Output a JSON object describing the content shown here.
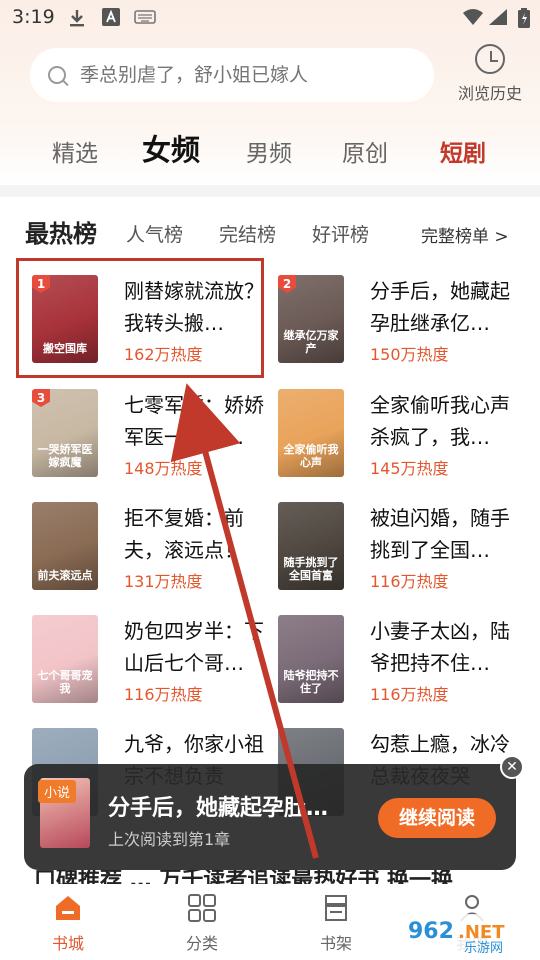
{
  "status": {
    "time": "3:19"
  },
  "search": {
    "placeholder": "季总别虐了，舒小姐已嫁人"
  },
  "history": {
    "label": "浏览历史"
  },
  "tabs": [
    "精选",
    "女频",
    "男频",
    "原创",
    "短剧"
  ],
  "section": {
    "title": "最热榜",
    "tabs": [
      "人气榜",
      "完结榜",
      "好评榜"
    ],
    "more": "完整榜单 >"
  },
  "books": [
    {
      "rank": "1",
      "title": "刚替嫁就流放？我转头搬…",
      "heat": "162万热度",
      "cover_text": "搬空国库",
      "cover_color": "#a8323a"
    },
    {
      "rank": "2",
      "title": "分手后，她藏起孕肚继承亿…",
      "heat": "150万热度",
      "cover_text": "继承亿万家产",
      "cover_color": "#6b5a56"
    },
    {
      "rank": "3",
      "title": "七零军婚：娇娇军医一哭，…",
      "heat": "148万热度",
      "cover_text": "一哭娇军医嫁疯魔",
      "cover_color": "#c7b8a3"
    },
    {
      "rank": "",
      "title": "全家偷听我心声杀疯了，我…",
      "heat": "145万热度",
      "cover_text": "全家偷听我心声",
      "cover_color": "#e9a35a"
    },
    {
      "rank": "",
      "title": "拒不复婚：前夫，滚远点！",
      "heat": "131万热度",
      "cover_text": "前夫滚远点",
      "cover_color": "#8a6b54"
    },
    {
      "rank": "",
      "title": "被迫闪婚，随手挑到了全国…",
      "heat": "116万热度",
      "cover_text": "随手挑到了全国首富",
      "cover_color": "#4e463f"
    },
    {
      "rank": "",
      "title": "奶包四岁半：下山后七个哥…",
      "heat": "116万热度",
      "cover_text": "七个哥哥宠我",
      "cover_color": "#f2c4c8"
    },
    {
      "rank": "",
      "title": "小妻子太凶，陆爷把持不住…",
      "heat": "116万热度",
      "cover_text": "陆爷把持不住了",
      "cover_color": "#7b6b78"
    },
    {
      "rank": "",
      "title": "九爷，你家小祖宗不想负责",
      "heat": "",
      "cover_text": "",
      "cover_color": "#8fa1b3"
    },
    {
      "rank": "",
      "title": "勾惹上瘾，冰冷总裁夜夜哭",
      "heat": "",
      "cover_text": "",
      "cover_color": "#6a6d73"
    }
  ],
  "popup": {
    "tag": "小说",
    "title": "分手后，她藏起孕肚…",
    "subtitle": "上次阅读到第1章",
    "button": "继续阅读"
  },
  "peek_text": "口碑推荐 … 万千读者追读最热好书  换一换",
  "nav": [
    "书城",
    "分类",
    "书架",
    "我的"
  ],
  "watermark": "962.NET 乐游网",
  "colors": {
    "accent": "#e4572e",
    "highlight": "#c0392b"
  }
}
